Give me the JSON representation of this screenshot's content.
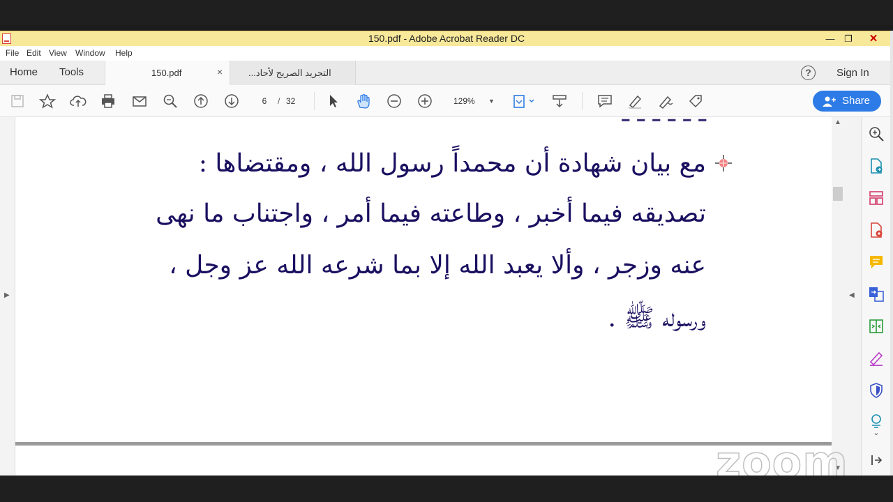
{
  "window": {
    "title": "150.pdf - Adobe Acrobat Reader DC",
    "min": "—",
    "max": "❐",
    "close": "✕"
  },
  "menu": [
    "File",
    "Edit",
    "View",
    "Window",
    "Help"
  ],
  "nav": {
    "home": "Home",
    "tools": "Tools"
  },
  "tabs": [
    {
      "label": "150.pdf",
      "close": "×"
    },
    {
      "label": "التجريد الصريح لأحاد..."
    }
  ],
  "header": {
    "help": "?",
    "sign_in": "Sign In"
  },
  "toolbar": {
    "page_current": "6",
    "page_sep": "/",
    "page_total": "32",
    "zoom": "129%",
    "share_label": "Share"
  },
  "document": {
    "lines": [
      "مع بيان شهادة أن محمداً رسول الله ، ومقتضاها :",
      "تصديقه فيما أخبر ، وطاعته فيما أمر ، واجتناب ما نهى",
      "عنه وزجر ، وألا يعبد الله إلا بما شرعه الله عز وجل ،",
      "ورسوله ﷺ ."
    ]
  },
  "watermark": "zoom",
  "colors": {
    "title_bar": "#f8e89a",
    "share": "#2d7be6",
    "arabic_text": "#1a1060"
  }
}
